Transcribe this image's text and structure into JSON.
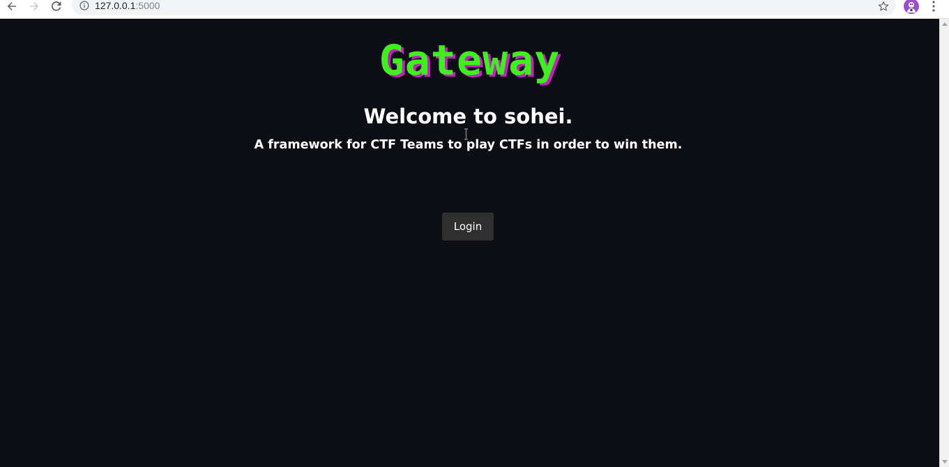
{
  "browser": {
    "url_host": "127.0.0.1",
    "url_port": ":5000",
    "icons": {
      "back": "back-arrow-icon",
      "forward": "forward-arrow-icon",
      "reload": "reload-icon",
      "info": "info-icon",
      "bookmark": "star-icon",
      "profile": "profile-avatar",
      "menu": "kebab-menu-icon"
    }
  },
  "page": {
    "logo": "Gateway",
    "welcome": "Welcome to sohei.",
    "tagline": "A framework for CTF Teams to play CTFs in order to win them.",
    "login_label": "Login"
  },
  "colors": {
    "background": "#0e0f14",
    "logo_green": "#3ef01e",
    "logo_shadow": "#c81ec8",
    "button_bg": "#2f2f30",
    "text": "#ffffff"
  }
}
